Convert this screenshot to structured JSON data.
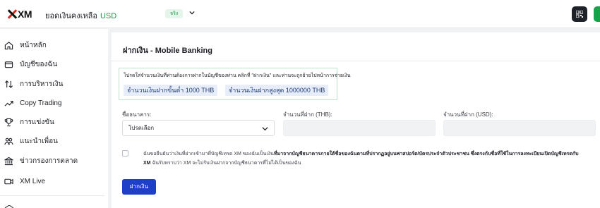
{
  "header": {
    "logo_text": "XM",
    "balance_label": "ยอดเงินคงเหลือ",
    "currency": "USD",
    "account_type_badge": "จริง",
    "icons": [
      "chevron-down-icon",
      "qr-code-icon"
    ]
  },
  "sidebar": {
    "items": [
      {
        "label": "หน้าหลัก",
        "icon": "home-icon"
      },
      {
        "label": "บัญชีของฉัน",
        "icon": "wallet-icon"
      },
      {
        "label": "การบริหารเงิน",
        "icon": "transfer-icon"
      },
      {
        "label": "Copy Trading",
        "icon": "trend-icon"
      },
      {
        "label": "การแข่งขัน",
        "icon": "trophy-icon"
      },
      {
        "label": "แนะนำเพื่อน",
        "icon": "friends-icon"
      },
      {
        "label": "ข่าวกรองการตลาด",
        "icon": "bank-icon"
      },
      {
        "label": "XM Live",
        "icon": "video-icon"
      }
    ]
  },
  "deposit": {
    "title": "ฝากเงิน - Mobile Banking",
    "info_text": "โปรดใส่จำนวนเงินที่ท่านต้องการฝากในบัญชีของท่าน คลิกที่ \"ฝากเงิน\" และท่านจะถูกย้ายไปหน้าการจ่ายเงิน",
    "min_deposit": "จำนวนเงินฝากขั้นต่ำ 1000 THB",
    "max_deposit": "จำนวนเงินฝากสูงสุด 1000000 THB",
    "bank_label": "ชื่อธนาคาร:",
    "bank_selected": "โปรดเลือก",
    "amount_thb_label": "จำนวนที่ฝาก (THB):",
    "amount_usd_label": "จำนวนที่ฝาก (USD):",
    "consent_normal_1": "ฉันขอยืนยันว่าเงินที่ฝากเข้ามาที่บัญชีเทรด XM ของฉันเป็นเงิน",
    "consent_bold": "ที่มาจากบัญชีธนาคารภายใต้ชื่อของฉันตามที่ปรากฏอยู่บนพาสปอร์ต/บัตรประจำตัวประชาชน ซึ่งตรงกับชื่อที่ใช้ในการลงทะเบียนเปิดบัญชีเทรดกับ XM",
    "consent_normal_2": " ฉันรับทราบว่า XM จะไม่รับเงินฝากจากบัญชีธนาคารที่ไม่ได้เป็นของฉัน",
    "submit_label": "ฝากเงิน"
  },
  "colors": {
    "accent_blue": "#1e40c8",
    "green": "#1a9b4b",
    "dark": "#1e2228"
  }
}
